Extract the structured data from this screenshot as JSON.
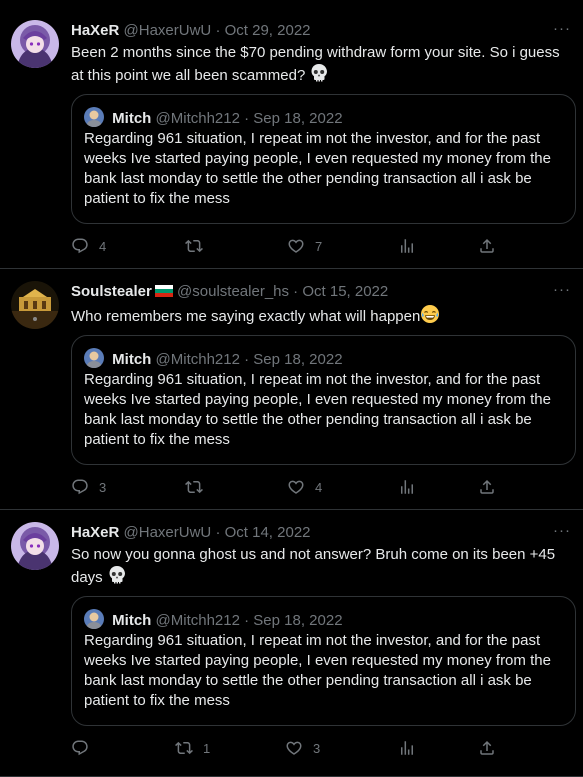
{
  "tweets": [
    {
      "name": "HaXeR",
      "handle": "@HaxerUwU",
      "sep": "·",
      "date": "Oct 29, 2022",
      "text": "Been 2 months since the $70 pending withdraw form your site. So i guess at this point we all been scammed?",
      "emoji": "skull",
      "quote": {
        "name": "Mitch",
        "handle": "@Mitchh212",
        "sep": "·",
        "date": "Sep 18, 2022",
        "text": "Regarding 961 situation, I repeat im not the investor, and for the past weeks Ive started paying people, I even requested my money from the bank last monday to settle the other pending transaction all i ask be patient to fix the mess"
      },
      "replies": "4",
      "retweets": "",
      "likes": "7"
    },
    {
      "name": "Soulstealer",
      "handle": "@soulstealer_hs",
      "sep": "·",
      "date": "Oct 15, 2022",
      "text": "Who remembers me saying exactly what will happen",
      "emoji": "joy",
      "quote": {
        "name": "Mitch",
        "handle": "@Mitchh212",
        "sep": "·",
        "date": "Sep 18, 2022",
        "text": "Regarding 961 situation, I repeat im not the investor, and for the past weeks Ive started paying people, I even requested my money from the bank last monday to settle the other pending transaction all i ask be patient to fix the mess"
      },
      "replies": "3",
      "retweets": "",
      "likes": "4"
    },
    {
      "name": "HaXeR",
      "handle": "@HaxerUwU",
      "sep": "·",
      "date": "Oct 14, 2022",
      "text": "So now you gonna ghost us and not answer? Bruh come on its been +45 days",
      "emoji": "skull",
      "quote": {
        "name": "Mitch",
        "handle": "@Mitchh212",
        "sep": "·",
        "date": "Sep 18, 2022",
        "text": "Regarding 961 situation, I repeat im not the investor, and for the past weeks Ive started paying people, I even requested my money from the bank last monday to settle the other pending transaction all i ask be patient to fix the mess"
      },
      "replies": "",
      "retweets": "1",
      "likes": "3"
    }
  ],
  "more_label": "···",
  "colors": {
    "background": "#000000",
    "text": "#e7e9ea",
    "muted": "#71767b",
    "border": "#2f3336"
  }
}
